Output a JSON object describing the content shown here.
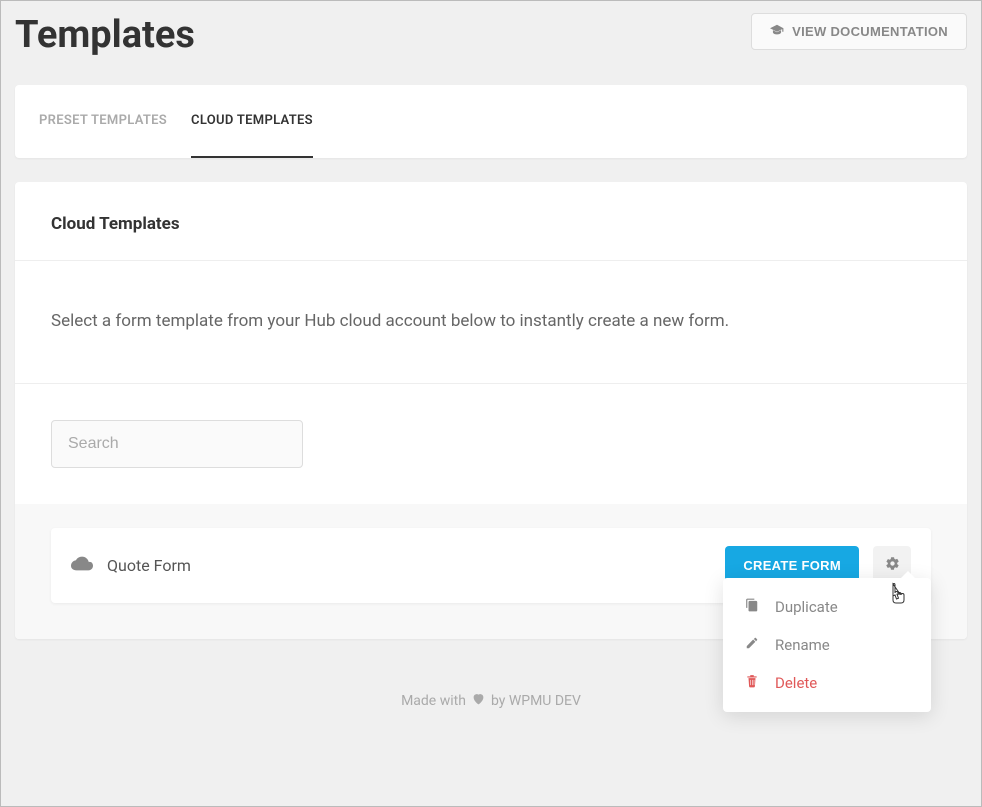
{
  "header": {
    "title": "Templates",
    "docButton": "VIEW DOCUMENTATION"
  },
  "tabs": [
    {
      "label": "PRESET TEMPLATES",
      "active": false
    },
    {
      "label": "CLOUD TEMPLATES",
      "active": true
    }
  ],
  "section": {
    "title": "Cloud Templates",
    "description": "Select a form template from your Hub cloud account below to instantly create a new form."
  },
  "search": {
    "placeholder": "Search",
    "value": ""
  },
  "templates": [
    {
      "name": "Quote Form",
      "createLabel": "CREATE FORM"
    }
  ],
  "dropdown": {
    "duplicate": "Duplicate",
    "rename": "Rename",
    "delete": "Delete"
  },
  "footer": {
    "prefix": "Made with",
    "suffix": "by WPMU DEV"
  },
  "icons": {
    "doc": "graduation-cap-icon",
    "cloud": "cloud-icon",
    "gear": "gear-icon",
    "copy": "copy-icon",
    "pencil": "pencil-icon",
    "trash": "trash-icon",
    "heart": "heart-icon"
  }
}
